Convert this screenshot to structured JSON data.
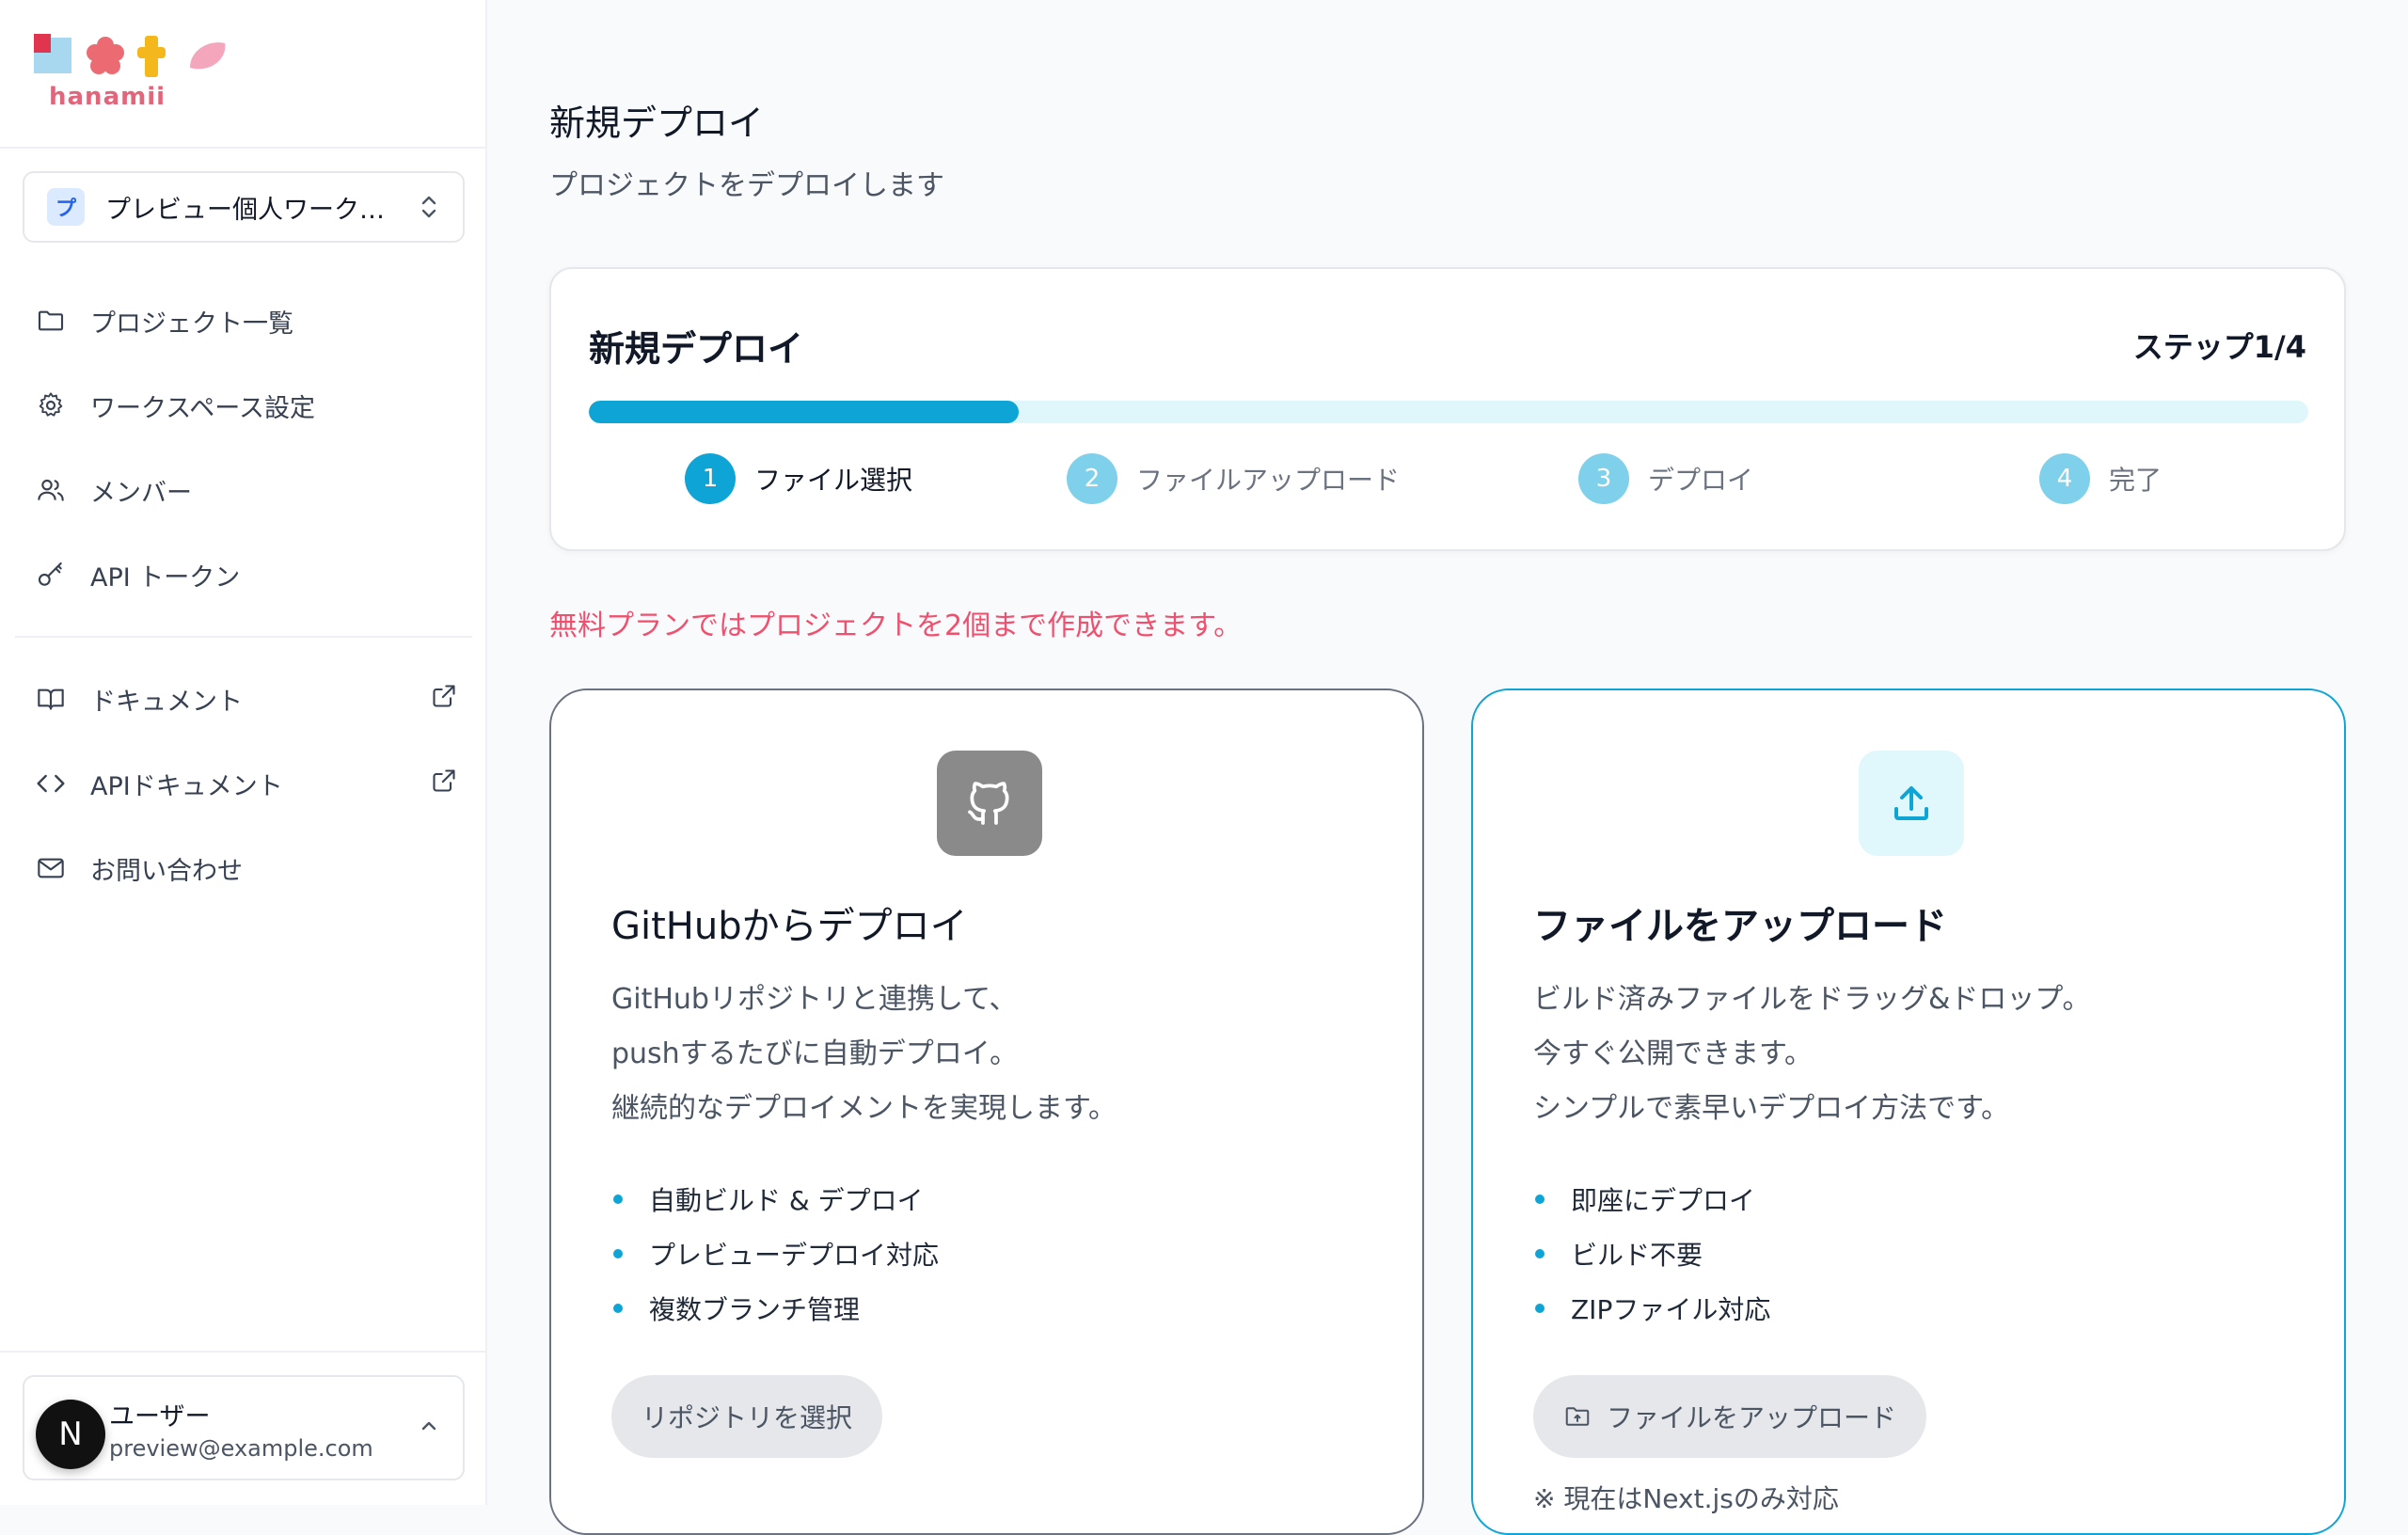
{
  "brand": {
    "name": "hanamii"
  },
  "workspace": {
    "badge": "プ",
    "label": "プレビュー個人ワーク…"
  },
  "nav": {
    "main": [
      {
        "label": "プロジェクト一覧",
        "icon": "folder-icon"
      },
      {
        "label": "ワークスペース設定",
        "icon": "gear-icon"
      },
      {
        "label": "メンバー",
        "icon": "users-icon"
      },
      {
        "label": "API トークン",
        "icon": "key-icon"
      }
    ],
    "secondary": [
      {
        "label": "ドキュメント",
        "icon": "book-icon",
        "external": true
      },
      {
        "label": "APIドキュメント",
        "icon": "code-icon",
        "external": true
      },
      {
        "label": "お問い合わせ",
        "icon": "mail-icon",
        "external": false
      }
    ]
  },
  "user": {
    "avatar": "N",
    "name": "ユーザー",
    "email": "preview@example.com"
  },
  "page": {
    "title": "新規デプロイ",
    "subtitle": "プロジェクトをデプロイします"
  },
  "stepper": {
    "title": "新規デプロイ",
    "step_label": "ステップ1/4",
    "progress": 0.25,
    "steps": [
      {
        "num": "1",
        "label": "ファイル選択",
        "active": true
      },
      {
        "num": "2",
        "label": "ファイルアップロード",
        "active": false
      },
      {
        "num": "3",
        "label": "デプロイ",
        "active": false
      },
      {
        "num": "4",
        "label": "完了",
        "active": false
      }
    ]
  },
  "notice": "無料プランではプロジェクトを2個まで作成できます。",
  "options": {
    "github": {
      "title": "GitHubからデプロイ",
      "desc": [
        "GitHubリポジトリと連携して、",
        "pushするたびに自動デプロイ。",
        "継続的なデプロイメントを実現します。"
      ],
      "features": [
        "自動ビルド & デプロイ",
        "プレビューデプロイ対応",
        "複数ブランチ管理"
      ],
      "button": "リポジトリを選択"
    },
    "upload": {
      "title": "ファイルをアップロード",
      "desc": [
        "ビルド済みファイルをドラッグ&ドロップ。",
        "今すぐ公開できます。",
        "シンプルで素早いデプロイ方法です。"
      ],
      "features": [
        "即座にデプロイ",
        "ビルド不要",
        "ZIPファイル対応"
      ],
      "button": "ファイルをアップロード",
      "note": "※ 現在はNext.jsのみ対応"
    }
  },
  "colors": {
    "accent": "#0ea5d6",
    "notice": "#f0506e",
    "brand": "#e2667b"
  }
}
